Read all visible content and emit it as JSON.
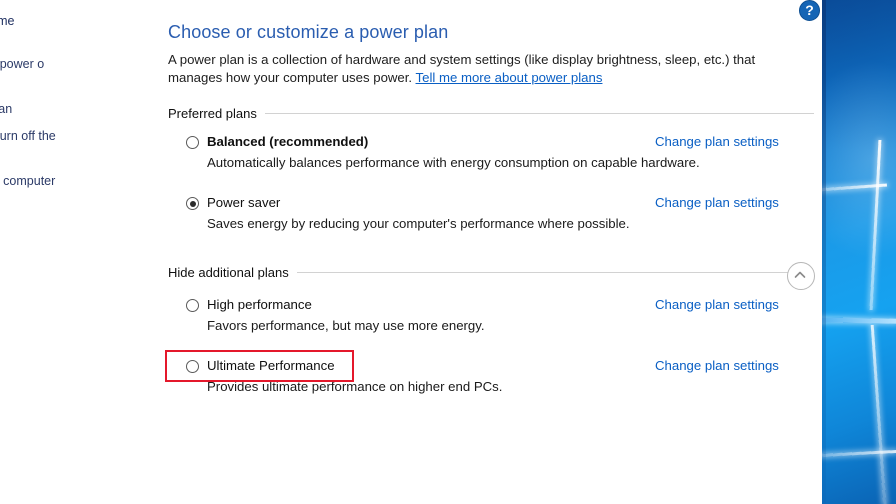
{
  "window": {
    "help_label": "?"
  },
  "nav": {
    "items": [
      {
        "label": "anel Home"
      },
      {
        "label": "hat the power\no"
      },
      {
        "label": "ower plan"
      },
      {
        "label": "hen to turn off the"
      },
      {
        "label": "hen the computer"
      }
    ]
  },
  "main": {
    "title": "Choose or customize a power plan",
    "intro_text": "A power plan is a collection of hardware and system settings (like display brightness, sleep, etc.) that manages how your computer uses power. ",
    "intro_link": "Tell me more about power plans",
    "preferred_plans_label": "Preferred plans",
    "additional_plans_label": "Hide additional plans",
    "collapse_icon": "chevron-up-icon",
    "change_link_label": "Change plan settings",
    "preferred_plans": [
      {
        "name": "Balanced (recommended)",
        "description": "Automatically balances performance with energy consumption on capable hardware.",
        "selected": false,
        "bold": true,
        "change_label": "Change plan settings"
      },
      {
        "name": "Power saver",
        "description": "Saves energy by reducing your computer's performance where possible.",
        "selected": true,
        "bold": false,
        "change_label": "Change plan settings"
      }
    ],
    "additional_plans": [
      {
        "name": "High performance",
        "description": "Favors performance, but may use more energy.",
        "selected": false,
        "bold": false,
        "change_label": "Change plan settings"
      },
      {
        "name": "Ultimate Performance",
        "description": "Provides ultimate performance on higher end PCs.",
        "selected": false,
        "bold": false,
        "change_label": "Change plan settings",
        "highlighted": true
      }
    ]
  },
  "annotation": {
    "color": "#e4182b",
    "target": "Ultimate Performance"
  },
  "colors": {
    "title_blue": "#2a5db0",
    "link_blue": "#0a5fc4",
    "nav_text": "#2b3a67",
    "highlight_red": "#e4182b",
    "desktop_blue": "#1b9ae8"
  }
}
